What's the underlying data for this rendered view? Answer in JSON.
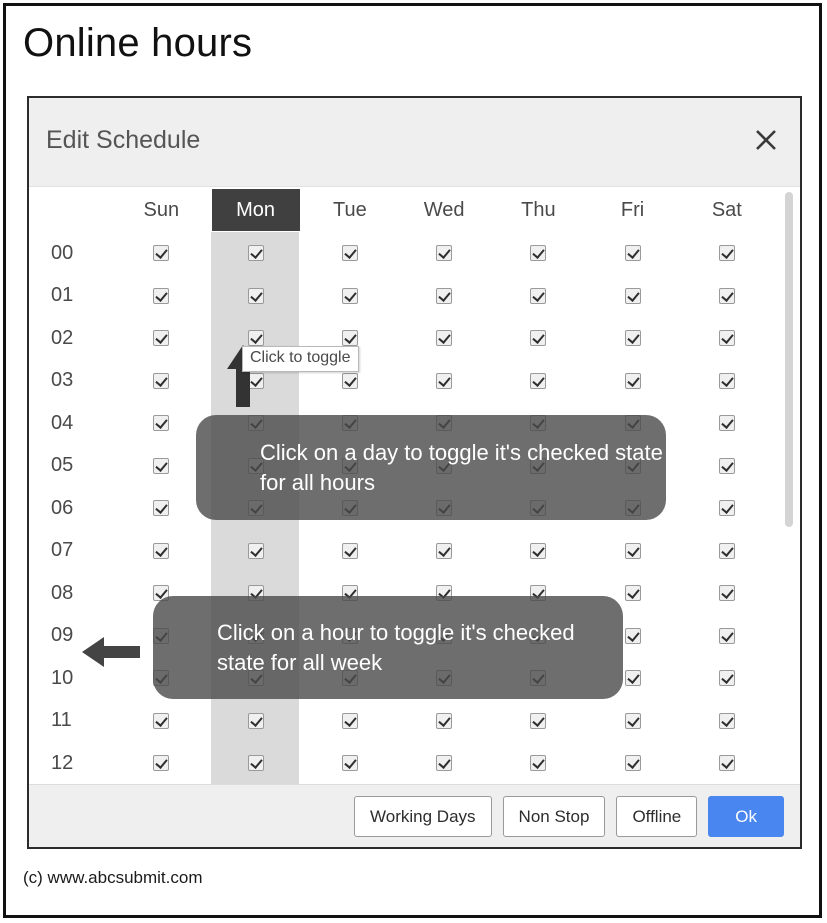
{
  "page": {
    "title": "Online hours",
    "copyright": "(c) www.abcsubmit.com"
  },
  "dialog": {
    "title": "Edit Schedule",
    "close_icon": "close-icon"
  },
  "schedule": {
    "hour_column_header": "",
    "days": [
      "Sun",
      "Mon",
      "Tue",
      "Wed",
      "Thu",
      "Fri",
      "Sat"
    ],
    "selected_day": "Mon",
    "hours": [
      "00",
      "01",
      "02",
      "03",
      "04",
      "05",
      "06",
      "07",
      "08",
      "09",
      "10",
      "11",
      "12"
    ],
    "checked": [
      [
        true,
        true,
        true,
        true,
        true,
        true,
        true
      ],
      [
        true,
        true,
        true,
        true,
        true,
        true,
        true
      ],
      [
        true,
        true,
        true,
        true,
        true,
        true,
        true
      ],
      [
        true,
        true,
        true,
        true,
        true,
        true,
        true
      ],
      [
        true,
        true,
        true,
        true,
        true,
        true,
        true
      ],
      [
        true,
        true,
        true,
        true,
        true,
        true,
        true
      ],
      [
        true,
        true,
        true,
        true,
        true,
        true,
        true
      ],
      [
        true,
        true,
        true,
        true,
        true,
        true,
        true
      ],
      [
        true,
        true,
        true,
        true,
        true,
        true,
        true
      ],
      [
        true,
        true,
        true,
        true,
        true,
        true,
        true
      ],
      [
        true,
        true,
        true,
        true,
        true,
        true,
        true
      ],
      [
        true,
        true,
        true,
        true,
        true,
        true,
        true
      ],
      [
        true,
        true,
        true,
        true,
        true,
        true,
        true
      ]
    ]
  },
  "tooltip": {
    "toggle_text": "Click to toggle"
  },
  "coach_marks": {
    "day": "Click on a day to toggle it's checked state for all hours",
    "hour": "Click on a hour to toggle it's checked state for all week"
  },
  "footer": {
    "buttons": [
      {
        "label": "Working Days",
        "style": "default"
      },
      {
        "label": "Non Stop",
        "style": "default"
      },
      {
        "label": "Offline",
        "style": "default"
      },
      {
        "label": "Ok",
        "style": "primary"
      }
    ]
  },
  "colors": {
    "accent": "#4a86f0",
    "selected_day_bg": "#404040",
    "column_highlight": "#dadada",
    "header_bg": "#efefef",
    "coach_overlay": "rgba(74,74,74,0.80)"
  }
}
